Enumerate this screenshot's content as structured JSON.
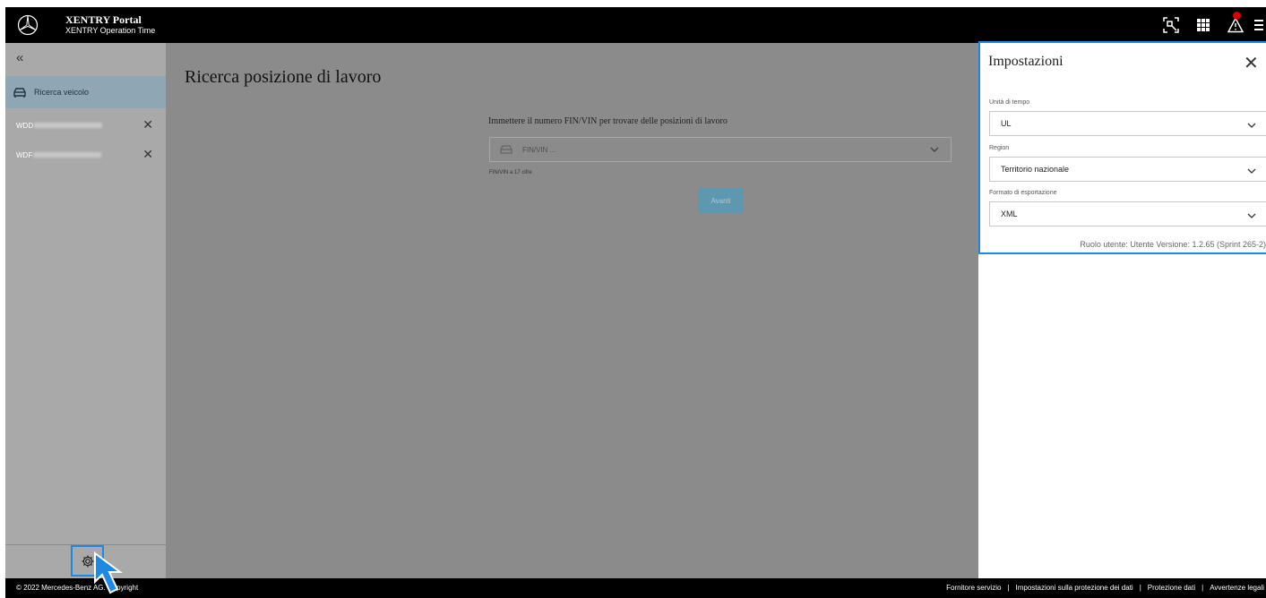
{
  "header": {
    "title": "XENTRY Portal",
    "subtitle": "XENTRY Operation Time"
  },
  "sidebar": {
    "collapse_glyph": "«",
    "active_item": {
      "label": "Ricerca veicolo",
      "icon": "car-icon"
    },
    "vehicles": [
      {
        "vin_prefix": "WDD"
      },
      {
        "vin_prefix": "WDF"
      }
    ]
  },
  "main": {
    "title": "Ricerca posizione di lavoro",
    "prompt": "Immettere il numero FIN/VIN per trovare delle posizioni di lavoro",
    "vin_placeholder": "FIN/VIN ...",
    "hint": "FIN/VIN a 17 cifre",
    "submit_label": "Avanti"
  },
  "settings_panel": {
    "title": "Impostazioni",
    "fields": [
      {
        "label": "Unità di tempo",
        "value": "UL"
      },
      {
        "label": "Region",
        "value": "Territorio nazionale"
      },
      {
        "label": "Formato di esportazione",
        "value": "XML"
      }
    ],
    "meta": "Ruolo utente: Utente Versione: 1.2.65 (Sprint 265-2)"
  },
  "footer": {
    "copyright": "© 2022 Mercedes-Benz AG. Copyright",
    "links": [
      "Fornitore servizio",
      "Impostazioni sulla protezione dei dati",
      "Protezione dati",
      "Avvertenze legali"
    ]
  },
  "colors": {
    "accent": "#1e88e5",
    "active_item": "#8fa7b4",
    "alert": "#d20000"
  }
}
